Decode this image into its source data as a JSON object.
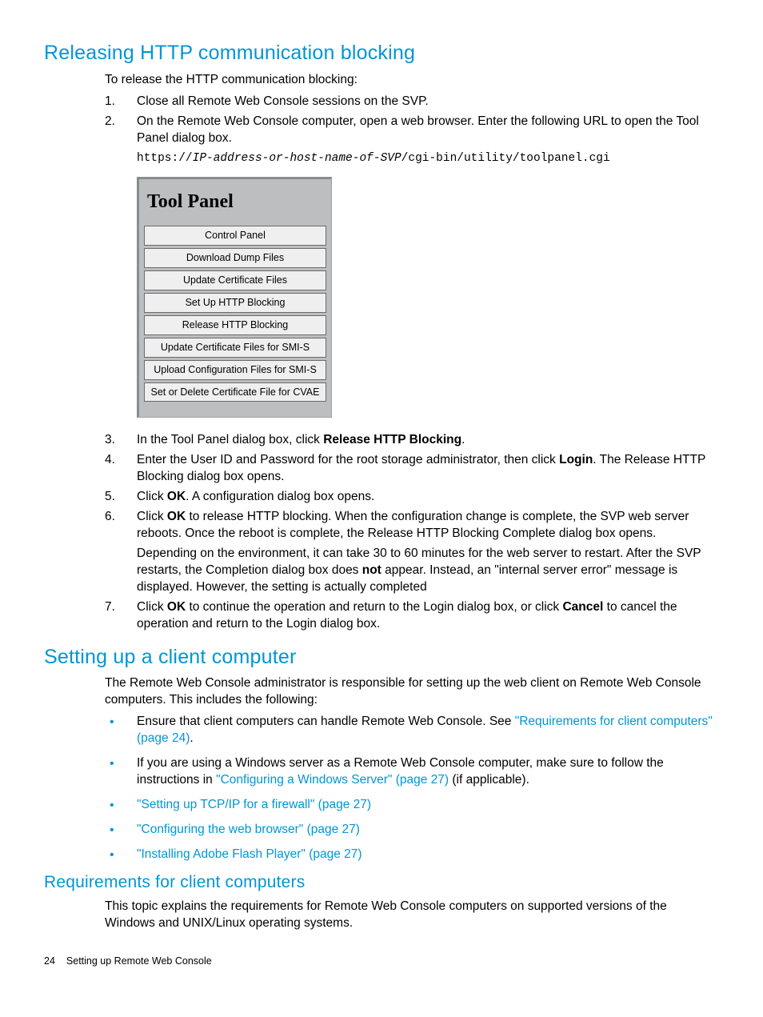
{
  "section1": {
    "heading": "Releasing HTTP communication blocking",
    "intro": "To release the HTTP communication blocking:",
    "steps": {
      "s1": "Close all Remote Web Console sessions on the SVP.",
      "s2": "On the Remote Web Console computer, open a web browser. Enter the following URL to open the Tool Panel dialog box.",
      "url_pre": "https://",
      "url_var": "IP-address-or-host-name-of-SVP",
      "url_post": "/cgi-bin/utility/toolpanel.cgi",
      "s3_a": "In the Tool Panel dialog box, click ",
      "s3_b": "Release HTTP Blocking",
      "s3_c": ".",
      "s4_a": "Enter the User ID and Password for the root storage administrator, then click ",
      "s4_b": "Login",
      "s4_c": ". The Release HTTP Blocking dialog box opens.",
      "s5_a": "Click ",
      "s5_b": "OK",
      "s5_c": ". A configuration dialog box opens.",
      "s6_a": "Click ",
      "s6_b": "OK",
      "s6_c": " to release HTTP blocking. When the configuration change is complete, the SVP web server reboots. Once the reboot is complete, the Release HTTP Blocking Complete dialog box opens.",
      "s6_note_a": "Depending on the environment, it can take 30 to 60 minutes for the web server to restart. After the SVP restarts, the Completion dialog box does ",
      "s6_note_b": "not",
      "s6_note_c": " appear. Instead, an \"internal server error\" message is displayed. However, the setting is actually completed",
      "s7_a": "Click ",
      "s7_b": "OK",
      "s7_c": " to continue the operation and return to the Login dialog box, or click ",
      "s7_d": "Cancel",
      "s7_e": " to cancel the operation and return to the Login dialog box."
    },
    "toolpanel": {
      "title": "Tool Panel",
      "buttons": [
        "Control Panel",
        "Download Dump Files",
        "Update Certificate Files",
        "Set Up HTTP Blocking",
        "Release HTTP Blocking",
        "Update Certificate Files for SMI-S",
        "Upload Configuration Files for SMI-S",
        "Set or Delete Certificate File for CVAE"
      ]
    }
  },
  "section2": {
    "heading": "Setting up a client computer",
    "intro": "The Remote Web Console administrator is responsible for setting up the web client on Remote Web Console computers. This includes the following:",
    "bullets": {
      "b1_a": "Ensure that client computers can handle Remote Web Console. See ",
      "b1_link": "\"Requirements for client computers\" (page 24)",
      "b1_c": ".",
      "b2_a": "If you are using a Windows server as a Remote Web Console computer, make sure to follow the instructions in ",
      "b2_link": "\"Configuring a Windows Server\" (page 27)",
      "b2_c": " (if applicable).",
      "b3_link": "\"Setting up TCP/IP for a firewall\" (page 27)",
      "b4_link": "\"Configuring the web browser\" (page 27)",
      "b5_link": "\"Installing Adobe Flash Player\" (page 27)"
    }
  },
  "section3": {
    "heading": "Requirements for client computers",
    "intro": "This topic explains the requirements for Remote Web Console computers on supported versions of the Windows and UNIX/Linux operating systems."
  },
  "footer": {
    "page": "24",
    "title": "Setting up Remote Web Console"
  }
}
